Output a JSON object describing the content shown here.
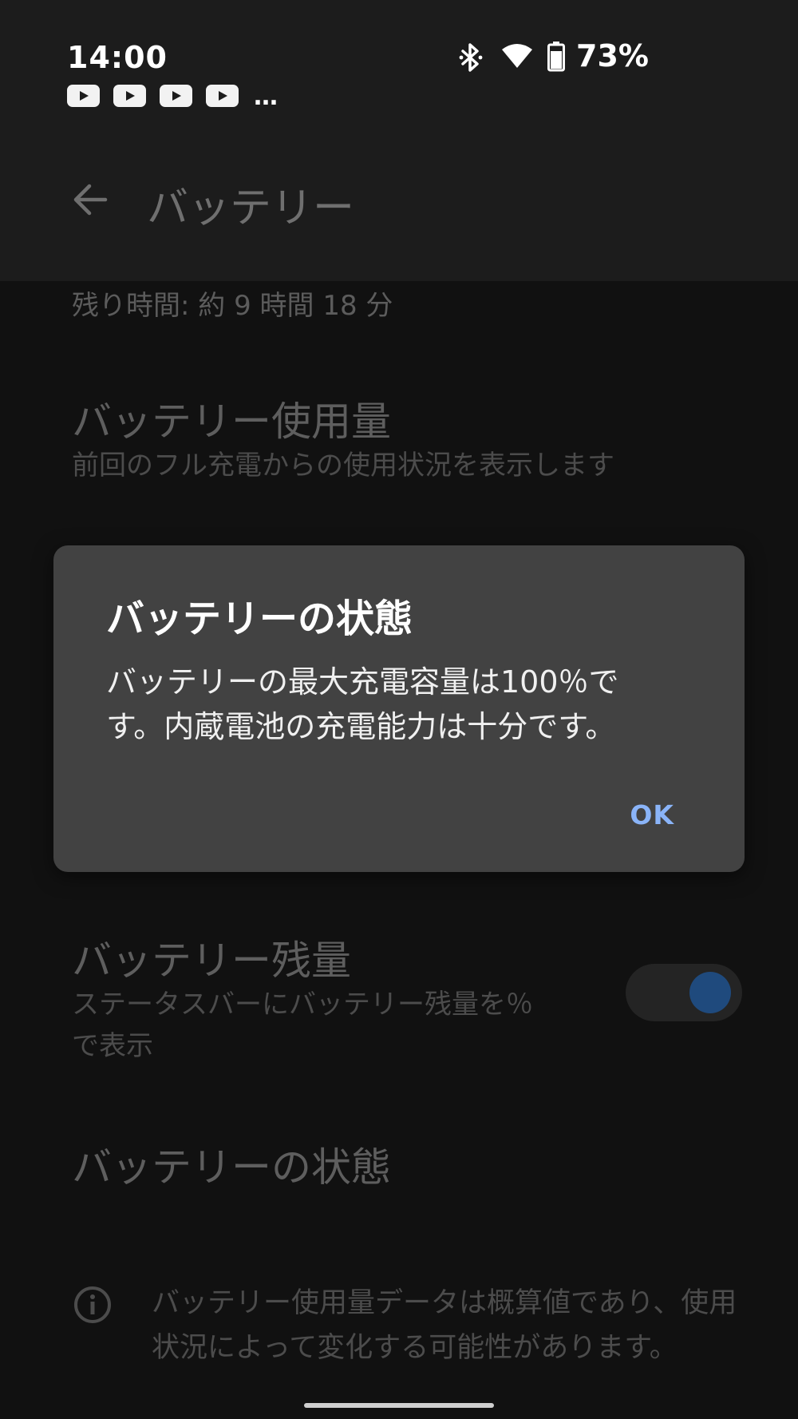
{
  "status_bar": {
    "time": "14:00",
    "notifications": [
      "youtube-icon",
      "youtube-icon",
      "youtube-icon",
      "youtube-icon"
    ],
    "more": "…",
    "battery_percent": "73%"
  },
  "app_bar": {
    "title": "バッテリー"
  },
  "list": {
    "remaining_time": "残り時間: 約 9 時間 18 分",
    "items": [
      {
        "title": "バッテリー使用量",
        "subtitle": "前回のフル充電からの使用状況を表示します"
      },
      {
        "title": "バッテリー残量",
        "subtitle_line1": "ステータスバーにバッテリー残量を％",
        "subtitle_line2": "で表示",
        "toggle_on": true
      },
      {
        "title": "バッテリーの状態"
      }
    ],
    "info_text": "バッテリー使用量データは概算値であり、使用状況によって変化する可能性があります。"
  },
  "dialog": {
    "title": "バッテリーの状態",
    "body_line1": "バッテリーの最大充電容量は100％で",
    "body_line2": "す。内蔵電池の充電能力は十分です。",
    "ok_label": "OK"
  },
  "colors": {
    "accent": "#8ab4f8",
    "toggle_knob": "#1f4a7d",
    "dialog_bg": "#424242"
  }
}
